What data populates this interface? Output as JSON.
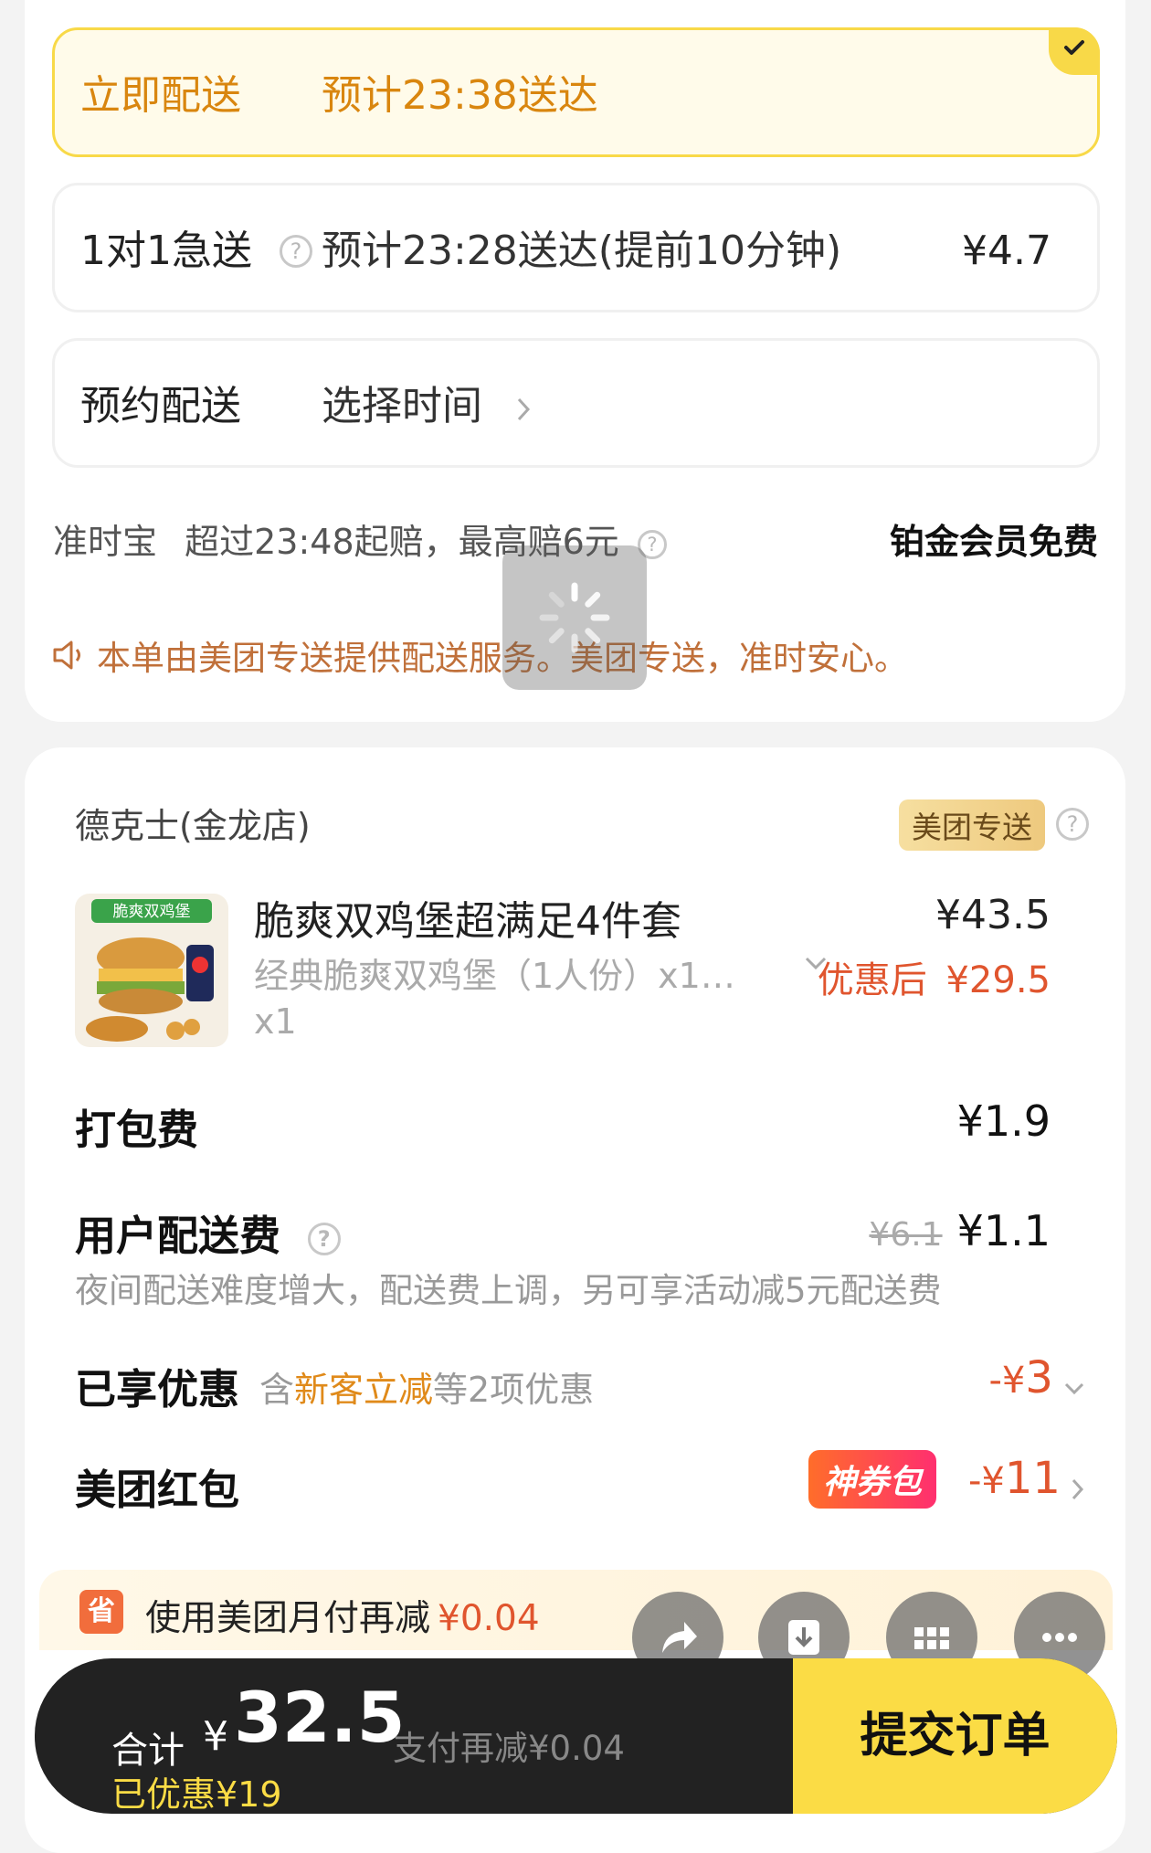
{
  "delivery": {
    "options": [
      {
        "label": "立即配送",
        "eta": "预计23:38送达",
        "fee": ""
      },
      {
        "label": "1对1急送",
        "eta": "预计23:28送达(提前10分钟)",
        "fee": "¥4.7"
      },
      {
        "label": "预约配送",
        "eta": "选择时间",
        "fee": ""
      }
    ],
    "ontime_label": "准时宝",
    "ontime_desc": "超过23:48起赔，最高赔6元",
    "ontime_right": "铂金会员免费",
    "notice": "本单由美团专送提供配送服务。美团专送，准时安心。"
  },
  "order": {
    "store": "德克士(金龙店)",
    "store_badge": "美团专送",
    "product": {
      "image_text": "脆爽双鸡堡",
      "name": "脆爽双鸡堡超满足4件套",
      "desc": "经典脆爽双鸡堡（1人份）x1…",
      "qty": "x1",
      "price": "¥43.5",
      "discount_label": "优惠后",
      "discount_price": "¥29.5"
    },
    "packing": {
      "label": "打包费",
      "value": "¥1.9"
    },
    "delivery_fee": {
      "label": "用户配送费",
      "original": "¥6.1",
      "value": "¥1.1",
      "note": "夜间配送难度增大，配送费上调，另可享活动减5元配送费"
    },
    "discounts": {
      "label": "已享优惠",
      "prefix": "含",
      "highlight": "新客立减",
      "suffix": "等2项优惠",
      "value_prefix": "-¥",
      "value_num": "3"
    },
    "redpacket": {
      "label": "美团红包",
      "badge": "神券包",
      "value_prefix": "-¥",
      "value_num": "11"
    }
  },
  "pay_promo": {
    "icon": "省",
    "text": "使用美团月付再减",
    "amount": "¥0.04"
  },
  "footer": {
    "total_label": "合计",
    "currency": "¥",
    "total": "32.5",
    "extra": "支付再减¥0.04",
    "saved": "已优惠¥19",
    "submit": "提交订单"
  },
  "colors": {
    "accent": "#fbdc45",
    "orange_text": "#d9860f",
    "discount_red": "#e0552e",
    "dark_bar": "#222222"
  }
}
